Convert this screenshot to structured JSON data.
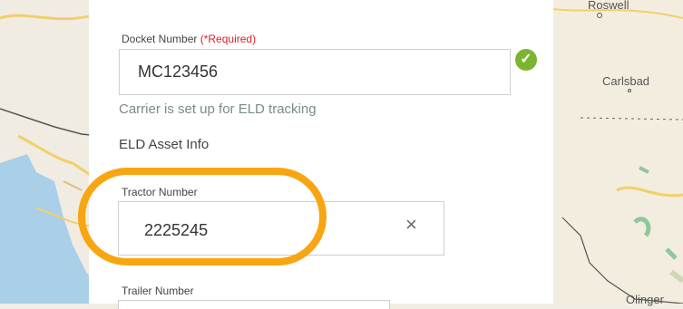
{
  "map": {
    "labels": {
      "roswell": "Roswell",
      "carlsbad": "Carlsbad",
      "olinger": "Olinger"
    }
  },
  "form": {
    "docket": {
      "label": "Docket Number",
      "required": "(*Required)",
      "value": "MC123456",
      "status": "Carrier is set up for ELD tracking"
    },
    "eld_section": "ELD Asset Info",
    "tractor": {
      "label": "Tractor Number",
      "value": "2225245",
      "clear_icon": "×"
    },
    "trailer": {
      "label": "Trailer Number"
    }
  },
  "colors": {
    "highlight": "#f7a511",
    "success": "#7bb52f",
    "required": "#e02020"
  }
}
